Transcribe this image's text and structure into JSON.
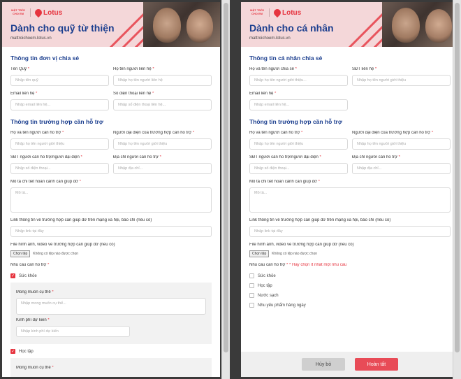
{
  "colors": {
    "brand_red": "#e6343f",
    "title_blue": "#1c3f8f",
    "hero_pink": "#f4d7d9"
  },
  "branding": {
    "mtce_logo_text": "MẶT TRỜI CHO EM",
    "lotus_text": "Lotus",
    "url": "mattroichoem.lotus.vn"
  },
  "left": {
    "title": "Dành cho quỹ từ thiện",
    "section1": {
      "title": "Thông tin đơn vị chia sẻ",
      "fund_name": {
        "label": "Tên Quỹ",
        "placeholder": "Nhập tên quỹ"
      },
      "contact_name": {
        "label": "Họ tên người liên hệ",
        "placeholder": "Nhập họ tên người liên hệ"
      },
      "contact_email": {
        "label": "Email liên hệ",
        "placeholder": "Nhập email liên hệ..."
      },
      "contact_phone": {
        "label": "Số điện thoại liên hệ",
        "placeholder": "Nhập số điện thoại liên hệ..."
      }
    },
    "section2": {
      "title": "Thông tin trường hợp cần hỗ trợ",
      "person_name": {
        "label": "Họ và tên người cần hỗ trợ",
        "placeholder": "Nhập họ tên người giới thiệu"
      },
      "representative": {
        "label": "Người đại diện của trường hợp cần hỗ trợ",
        "placeholder": "Nhập họ tên người giới thiệu"
      },
      "phone": {
        "label": "SĐT người cần hỗ trợ/người đại diện",
        "placeholder": "Nhập số điện thoại..."
      },
      "address": {
        "label": "Địa chỉ người cần hỗ trợ",
        "placeholder": "Nhập địa chỉ..."
      },
      "description": {
        "label": "Mô tả chi tiết hoàn cảnh cần giúp đỡ",
        "placeholder": "Mô tả..."
      },
      "link": {
        "label": "Link thông tin về trường hợp cần giúp đỡ trên mạng xã hội, báo chí (nếu có)",
        "placeholder": "Nhập link tại đây"
      },
      "file": {
        "label": "File hình ảnh, video về trường hợp cần giúp đỡ (nếu có)",
        "button": "Chọn tệp",
        "status": "Không có tệp nào được chọn"
      },
      "needs_label": "Nhu cầu cần hỗ trợ",
      "need_health": "Sức khỏe",
      "wish": {
        "label": "Mong muốn cụ thể",
        "placeholder": "Nhập mong muốn cụ thể..."
      },
      "budget": {
        "label": "Kinh phí dự kiến",
        "placeholder": "Nhập kinh phí dự kiến"
      },
      "need_study": "Học tập",
      "wish2_label": "Mong muốn cụ thể"
    }
  },
  "right": {
    "title": "Dành cho cá nhân",
    "section1": {
      "title": "Thông tin cá nhân chia sẻ",
      "sharer_name": {
        "label": "Họ và tên người chia sẻ",
        "placeholder": "Nhập họ tên người giới thiệu..."
      },
      "phone": {
        "label": "SĐT liên hệ",
        "placeholder": "Nhập họ tên người giới thiệu"
      },
      "email": {
        "label": "Email liên hệ",
        "placeholder": "Nhập email liên hệ..."
      }
    },
    "section2": {
      "title": "Thông tin trường hợp cần hỗ trợ",
      "person_name": {
        "label": "Họ và tên người cần hỗ trợ",
        "placeholder": "Nhập họ tên người giới thiệu"
      },
      "representative": {
        "label": "Người đại diện của trường hợp cần hỗ trợ",
        "placeholder": "Nhập họ tên người giới thiệu"
      },
      "phone": {
        "label": "SĐT người cần hỗ trợ/người đại diện",
        "placeholder": "Nhập số điện thoại..."
      },
      "address": {
        "label": "Địa chỉ người cần hỗ trợ",
        "placeholder": "Nhập địa chỉ..."
      },
      "description": {
        "label": "Mô tả chi tiết hoàn cảnh cần giúp đỡ",
        "placeholder": "Mô tả..."
      },
      "link": {
        "label": "Link thông tin về trường hợp cần giúp đỡ trên mạng xã hội, báo chí (nếu có)",
        "placeholder": "Nhập link tại đây"
      },
      "file": {
        "label": "File hình ảnh, video về trường hợp cần giúp đỡ (nếu có)",
        "button": "Chọn tệp",
        "status": "Không có tệp nào được chọn"
      },
      "needs_label": "Nhu cầu cần hỗ trợ",
      "needs_hint": "* Hãy chọn ít nhất một nhu cầu",
      "options": [
        "Sức khỏe",
        "Học tập",
        "Nước sạch",
        "Nhu yếu phẩm hàng ngày"
      ]
    },
    "footer": {
      "cancel": "Hủy bỏ",
      "submit": "Hoàn tất"
    }
  }
}
